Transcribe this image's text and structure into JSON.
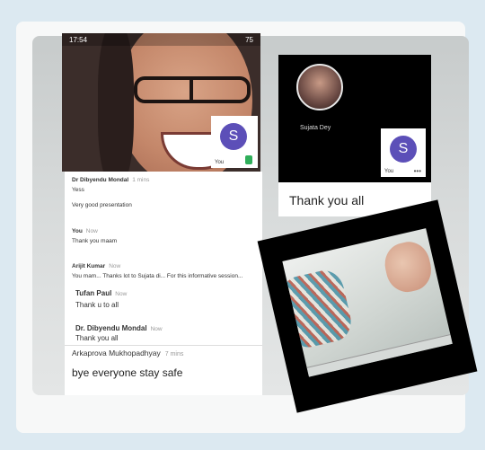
{
  "screenshot1": {
    "status_time": "17:54",
    "status_battery": "75",
    "tile": {
      "initial": "S",
      "label": "You"
    }
  },
  "screenshot2": {
    "participant_name": "Sujata Dey",
    "tile": {
      "initial": "S",
      "label": "You"
    },
    "message": "Thank you all"
  },
  "chat": {
    "messages": [
      {
        "author": "Dr Dibyendu Mondal",
        "time": "1 mins",
        "lines": [
          "Yess",
          "Very good presentation"
        ]
      },
      {
        "author": "You",
        "time": "Now",
        "lines": [
          "Thank you maam"
        ]
      },
      {
        "author": "Arijit Kumar",
        "time": "Now",
        "lines": [
          "You mam... Thanks lot to Sujata di... For this informative session..."
        ]
      },
      {
        "author": "Tufan Paul",
        "time": "Now",
        "lines": [
          "Thank u to all"
        ]
      },
      {
        "author": "Dr. Dibyendu Mondal",
        "time": "Now",
        "lines": [
          "Thank you all"
        ]
      }
    ],
    "last": {
      "author": "Arkaprova Mukhopadhyay",
      "time": "7 mins",
      "text": "bye everyone stay safe"
    }
  }
}
